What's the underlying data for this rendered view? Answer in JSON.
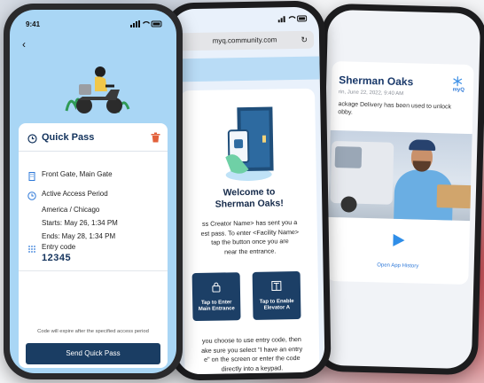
{
  "phone_left": {
    "status_time": "9:41",
    "card_title": "Quick Pass",
    "gate": "Front Gate, Main Gate",
    "access_heading": "Active Access Period",
    "timezone": "America / Chicago",
    "starts": "Starts: May 26, 1:34 PM",
    "ends": "Ends: May 28, 1:34 PM",
    "code_label": "Entry code",
    "code_value": "12345",
    "expire_note": "Code will expire after the specified access period",
    "send_button": "Send Quick Pass",
    "accent_color": "#1a3d63",
    "background_color": "#a9d6f5",
    "icons": [
      "chevron-left",
      "clock",
      "trash",
      "building",
      "clock",
      "keypad"
    ]
  },
  "phone_middle": {
    "url": "myq.community.com",
    "welcome_line1": "Welcome to",
    "welcome_line2": "Sherman Oaks!",
    "body_lines": [
      "ss Creator Name> has sent you a",
      "est pass. To enter <Facility Name>",
      "tap the button once you are",
      "near the entrance."
    ],
    "button_enter_line1": "Tap to Enter",
    "button_enter_line2": "Main Entrance",
    "button_elevator_line1": "Tap to Enable",
    "button_elevator_line2": "Elevator A",
    "bottom_lines": [
      "you choose to use entry code, then",
      "ake sure you select \"I have an entry",
      "e\" on the screen or enter the code",
      "directly into a keypad."
    ],
    "icons": [
      "reload",
      "lock",
      "elevator"
    ]
  },
  "phone_right": {
    "title": "Sherman Oaks",
    "date": "rin, June 22, 2022, 9:40 AM",
    "message_lines": [
      "ackage Delivery has been used to unlock",
      "obby."
    ],
    "brand": "myQ",
    "history_link": "Open App History",
    "icons": [
      "snowflake",
      "play"
    ]
  }
}
